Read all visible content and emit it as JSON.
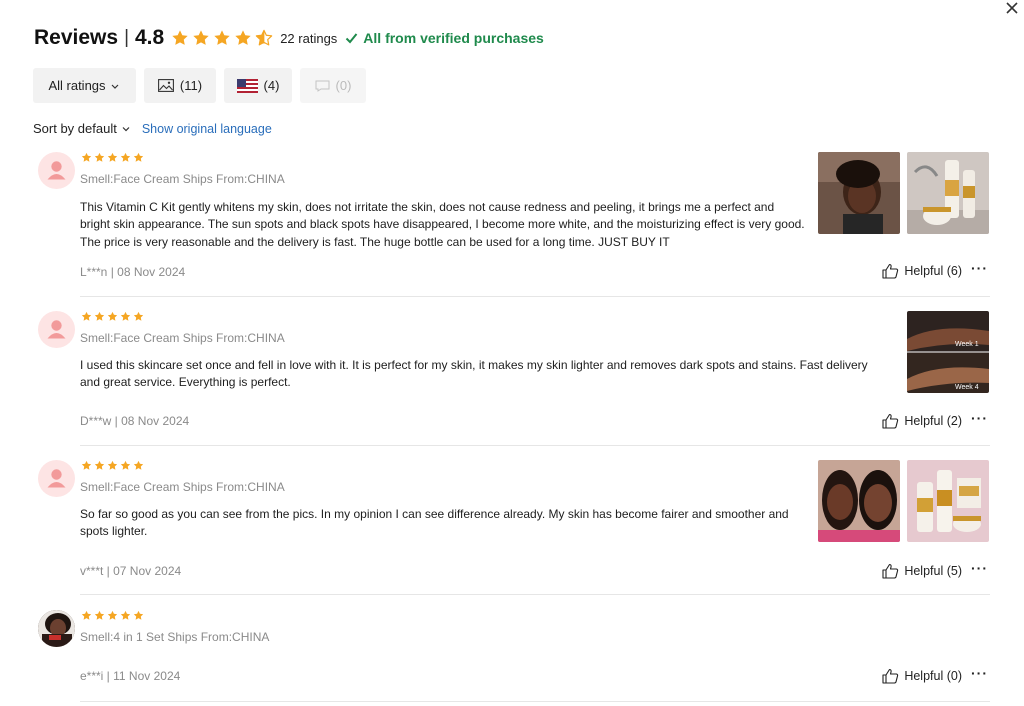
{
  "header": {
    "title": "Reviews",
    "separator": "|",
    "score": "4.8",
    "ratings_count": "22 ratings",
    "verified": "All from verified purchases"
  },
  "filters": {
    "all_ratings": "All ratings",
    "photos_count": "(11)",
    "country_count": "(4)",
    "comments_count": "(0)"
  },
  "sort": {
    "label": "Sort by default",
    "show_original": "Show original language"
  },
  "colors": {
    "star": "#f5a623",
    "verified": "#1f8a4c",
    "link": "#2a6ebb"
  },
  "reviews": [
    {
      "rating": 5,
      "meta": "Smell:Face Cream Ships From:CHINA",
      "text": "This Vitamin C Kit gently whitens my skin, does not irritate the skin, does not cause redness and peeling, it brings me a perfect and bright skin appearance. The sun spots and black spots have disappeared, I become more white, and the moisturizing effect is very good. The price is very reasonable and the delivery is fast. The huge bottle can be used for a long time. JUST BUY IT",
      "author_date": "L***n | 08 Nov 2024",
      "helpful": "Helpful (6)"
    },
    {
      "rating": 5,
      "meta": "Smell:Face Cream Ships From:CHINA",
      "text": "I used this skincare set once and fell in love with it. It is perfect for my skin, it makes my skin lighter and removes dark spots and stains. Fast delivery and great service. Everything is perfect.",
      "author_date": "D***w | 08 Nov 2024",
      "helpful": "Helpful (2)",
      "photo_labels": [
        "Week 1",
        "Week 4"
      ]
    },
    {
      "rating": 5,
      "meta": "Smell:Face Cream Ships From:CHINA",
      "text": "So far so good as you can see from the pics. In my opinion I can see difference already. My skin has become fairer and smoother and spots lighter.",
      "author_date": "v***t | 07 Nov 2024",
      "helpful": "Helpful (5)"
    },
    {
      "rating": 5,
      "meta": "Smell:4 in 1 Set Ships From:CHINA",
      "author_date": "e***i | 11 Nov 2024",
      "helpful": "Helpful (0)"
    }
  ],
  "more_label": "···",
  "icons": [
    "close-icon",
    "star-icon",
    "check-icon",
    "chevron-down-icon",
    "image-icon",
    "us-flag-icon",
    "comment-icon",
    "thumbs-up-icon",
    "more-icon"
  ]
}
